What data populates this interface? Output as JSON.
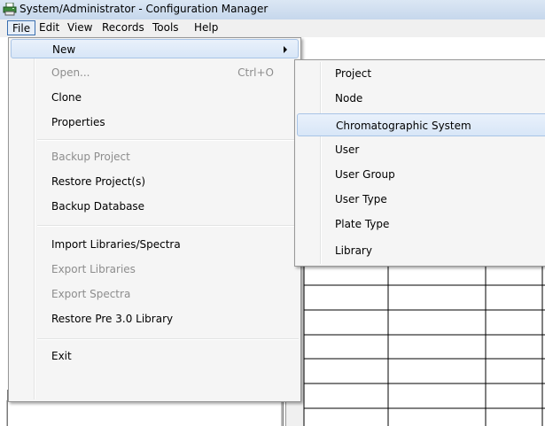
{
  "window": {
    "title": "System/Administrator - Configuration Manager",
    "icon": "printer-icon"
  },
  "menubar": {
    "items": [
      {
        "label": "File",
        "active": true
      },
      {
        "label": "Edit"
      },
      {
        "label": "View"
      },
      {
        "label": "Records"
      },
      {
        "label": "Tools"
      },
      {
        "label": "Help"
      }
    ]
  },
  "file_menu": {
    "items": [
      {
        "label": "New",
        "submenu": true,
        "highlight": true
      },
      {
        "label": "Open...",
        "shortcut": "Ctrl+O",
        "disabled": true
      },
      {
        "label": "Clone"
      },
      {
        "label": "Properties"
      },
      {
        "label": "Backup Project",
        "disabled": true
      },
      {
        "label": "Restore Project(s)"
      },
      {
        "label": "Backup Database"
      },
      {
        "label": "Import Libraries/Spectra"
      },
      {
        "label": "Export Libraries",
        "disabled": true
      },
      {
        "label": "Export Spectra",
        "disabled": true
      },
      {
        "label": "Restore Pre 3.0 Library"
      },
      {
        "label": "Exit"
      }
    ]
  },
  "new_submenu": {
    "items": [
      {
        "label": "Project"
      },
      {
        "label": "Node"
      },
      {
        "label": "Chromatographic System",
        "highlight": true
      },
      {
        "label": "User"
      },
      {
        "label": "User Group"
      },
      {
        "label": "User Type"
      },
      {
        "label": "Plate Type"
      },
      {
        "label": "Library"
      }
    ]
  }
}
